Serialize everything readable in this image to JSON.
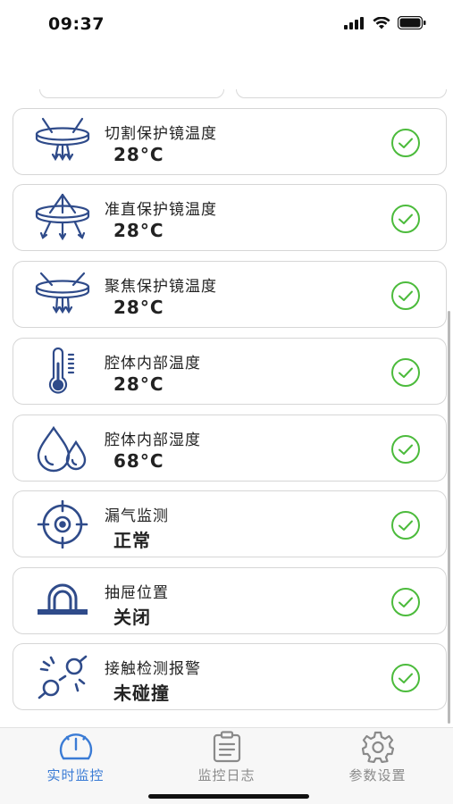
{
  "status_bar": {
    "time": "09:37"
  },
  "colors": {
    "accent": "#3a7bd5",
    "check": "#4cbb3c",
    "icon": "#2f4b8a",
    "inactive": "#8a8a8a"
  },
  "cards": [
    {
      "icon": "lens-cut-icon",
      "title": "切割保护镜温度",
      "value": "28°C",
      "status": "normal"
    },
    {
      "icon": "lens-collimate-icon",
      "title": "准直保护镜温度",
      "value": "28°C",
      "status": "normal"
    },
    {
      "icon": "lens-focus-icon",
      "title": "聚焦保护镜温度",
      "value": "28°C",
      "status": "normal"
    },
    {
      "icon": "thermometer-icon",
      "title": "腔体内部温度",
      "value": "28°C",
      "status": "normal"
    },
    {
      "icon": "humidity-drops-icon",
      "title": "腔体内部湿度",
      "value": "68°C",
      "status": "normal"
    },
    {
      "icon": "leak-target-icon",
      "title": "漏气监测",
      "value": "正常",
      "status": "normal"
    },
    {
      "icon": "drawer-position-icon",
      "title": "抽屉位置",
      "value": "关闭",
      "status": "normal"
    },
    {
      "icon": "collision-icon",
      "title": "接触检测报警",
      "value": "未碰撞",
      "status": "normal"
    }
  ],
  "tabs": [
    {
      "label": "实时监控",
      "icon": "gauge-icon",
      "active": true
    },
    {
      "label": "监控日志",
      "icon": "clipboard-icon",
      "active": false
    },
    {
      "label": "参数设置",
      "icon": "gear-icon",
      "active": false
    }
  ]
}
